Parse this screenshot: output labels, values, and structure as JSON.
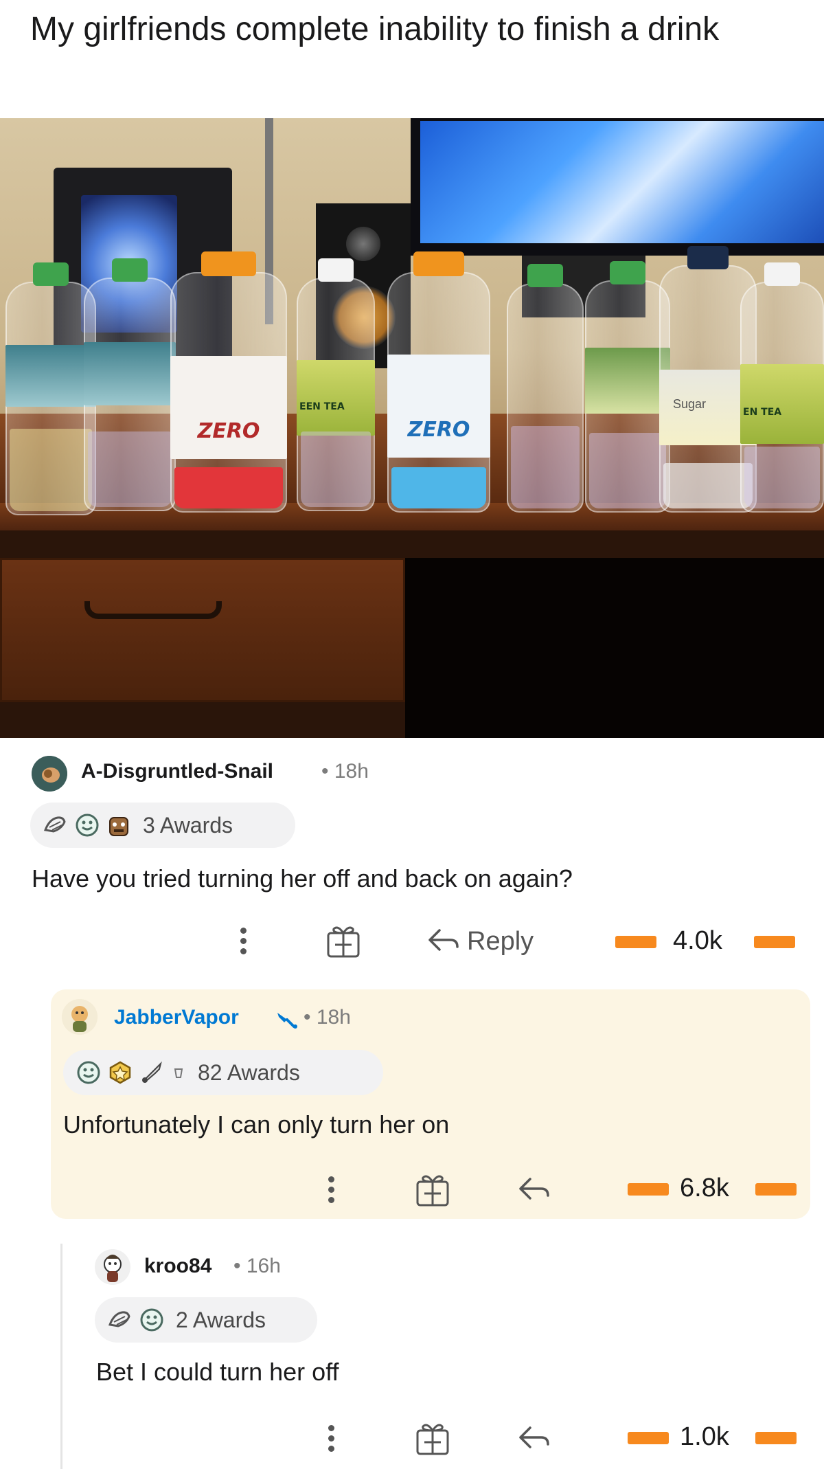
{
  "post": {
    "title": "My girlfriends complete inability to finish a drink"
  },
  "photo": {
    "bottle_labels": [
      "ZERO",
      "ZERO",
      "EEN TEA",
      "EN TEA",
      "Sugar"
    ]
  },
  "comments": [
    {
      "username": "A-Disgruntled-Snail",
      "time": "• 18h",
      "awards": "3 Awards",
      "body": "Have you tried turning her off and back on again?",
      "reply_label": "Reply",
      "score": "4.0k"
    },
    {
      "username": "JabberVapor",
      "time": "• 18h",
      "awards": "82 Awards",
      "body": "Unfortunately I can only turn her on",
      "score": "6.8k"
    },
    {
      "username": "kroo84",
      "time": "• 16h",
      "awards": "2 Awards",
      "body": "Bet I could turn her off",
      "score": "1.0k"
    }
  ],
  "colors": {
    "vote_accent": "#f7891e",
    "highlight_bg": "#fcf5e3",
    "username_link": "#0079d3"
  },
  "icons": [
    "overflow-dots-icon",
    "gift-award-icon",
    "reply-arrow-icon",
    "upvote-icon",
    "downvote-icon",
    "award-icon",
    "op-badge-icon"
  ]
}
